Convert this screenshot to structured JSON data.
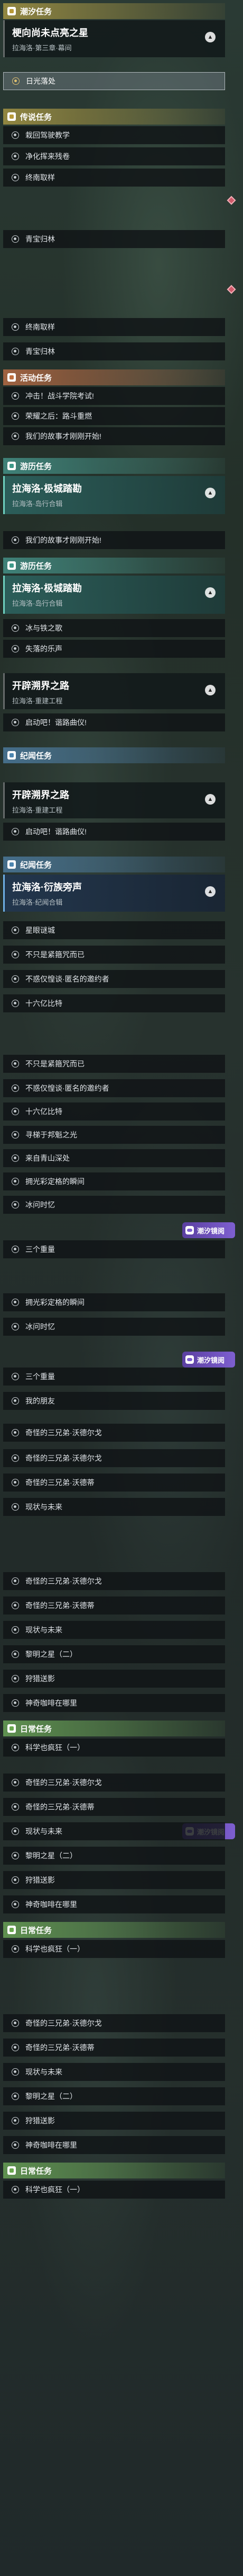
{
  "categories": {
    "tide": "潮汐任务",
    "legend": "传说任务",
    "event": "活动任务",
    "roam": "游历任务",
    "story": "纪闻任务",
    "daily": "日常任务"
  },
  "cards": {
    "pioneer": {
      "title": "梗向尚未点亮之星",
      "sub": "拉海洛·第三章·幕间"
    },
    "roam": {
      "title": "拉海洛·极城踏勘",
      "sub": "拉海洛·岛行合辑"
    },
    "roam2": {
      "title": "拉海洛·极城踏勘",
      "sub": "拉海洛·岛行合辑"
    },
    "open1": {
      "title": "开辟溯界之路",
      "sub": "拉海洛·重建工程"
    },
    "open2": {
      "title": "开辟溯界之路",
      "sub": "拉海洛·重建工程"
    },
    "story": {
      "title": "拉海洛·衍族旁声",
      "sub": "拉海洛·纪闻合辑"
    }
  },
  "items": {
    "i01": "日光落处",
    "i02": "栽回驾驶教学",
    "i03": "净化挥来残卷",
    "i04": "终南取样",
    "i05": "青宝归林",
    "i06": "终南取样",
    "i07": "青宝归林",
    "i08": "冲击！战斗学院考试!",
    "i09": "荣耀之后：路斗重燃",
    "i10": "我们的故事才刚刚开始!",
    "i11": "我们的故事才刚刚开始!",
    "i12": "冰与铁之歌",
    "i13": "失落的乐声",
    "i14": "启动吧！谐路曲仪!",
    "i15": "启动吧！谐路曲仪!",
    "i16": "星眼谜城",
    "i17": "不只是紧箍咒而已",
    "i18": "不惑仅惶谈·匿名的邀约者",
    "i19": "十六亿比特",
    "i20": "不只是紧箍咒而已",
    "i21": "不惑仅惶谈·匿名的邀约者",
    "i22": "十六亿比特",
    "i23": "寻梯于邦魁之光",
    "i24": "来自青山深处",
    "i25": "拥光彩定格的瞬间",
    "i26": "冰问时忆",
    "i27": "三个重量",
    "i28": "拥光彩定格的瞬间",
    "i29": "冰问时忆",
    "i30": "三个重量",
    "i31": "我的朋友",
    "i32": "奇怪的三兄弟·沃德尔戈",
    "i33": "奇怪的三兄弟·沃德尔戈",
    "i34": "奇怪的三兄弟·沃德蒂",
    "i35": "现状与未来",
    "i36": "奇怪的三兄弟·沃德尔戈",
    "i37": "奇怪的三兄弟·沃德蒂",
    "i38": "现状与未来",
    "i39": "黎明之星（二）",
    "i40": "狩猎送影",
    "i41": "神奇咖啡在哪里",
    "i42": "科学也疯狂（一）",
    "i43": "奇怪的三兄弟·沃德尔戈",
    "i44": "奇怪的三兄弟·沃德蒂",
    "i45": "现状与未来",
    "i46": "黎明之星（二）",
    "i47": "狩猎送影",
    "i48": "神奇咖啡在哪里",
    "i49": "科学也疯狂（一）",
    "i50": "奇怪的三兄弟·沃德尔戈",
    "i51": "奇怪的三兄弟·沃德蒂",
    "i52": "现状与未来",
    "i53": "黎明之星（二）",
    "i54": "狩猎送影",
    "i55": "神奇咖啡在哪里",
    "i56": "科学也疯狂（一）"
  },
  "watermark": "潮汐镜阅",
  "icons": {
    "category": "task-category-icon",
    "chevron": "chevron-up-icon",
    "quest": "quest-dot-icon",
    "marker": "red-diamond-marker-icon"
  },
  "colors": {
    "tide": "#b89a3a",
    "event": "#c07040",
    "roam": "#3d9a8a",
    "story": "#4d86b0",
    "daily": "#6aa84f",
    "logo": "#7e5fd0"
  }
}
